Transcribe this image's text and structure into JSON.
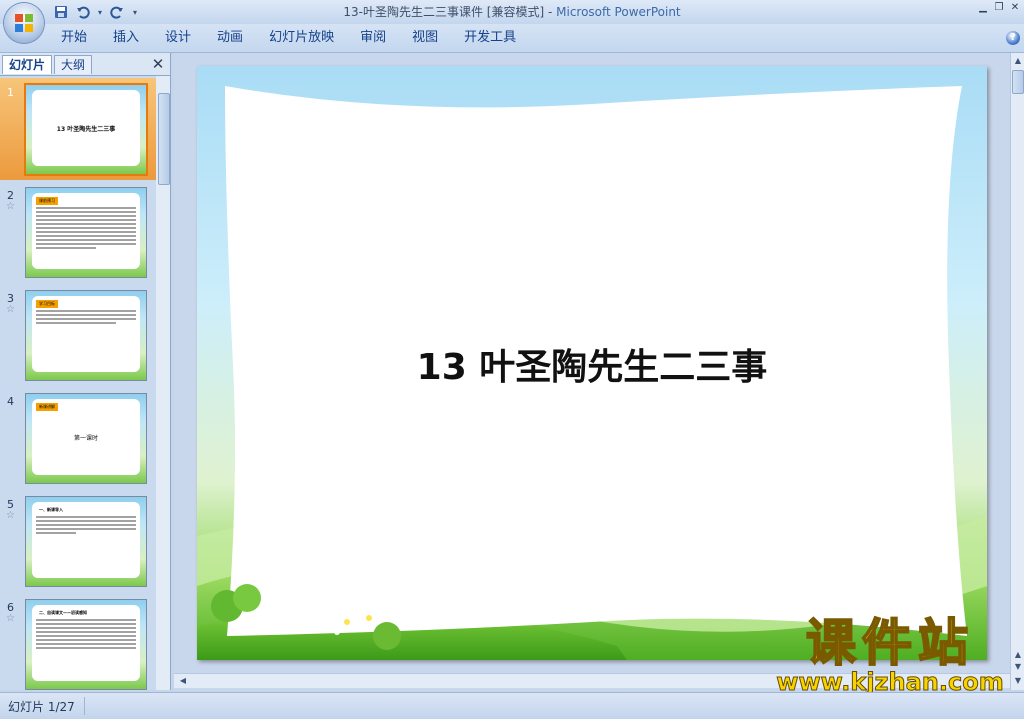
{
  "window": {
    "title": "13-叶圣陶先生二三事课件 [兼容模式]",
    "separator": " - ",
    "app_name": "Microsoft PowerPoint"
  },
  "ribbon": {
    "tabs": [
      "开始",
      "插入",
      "设计",
      "动画",
      "幻灯片放映",
      "审阅",
      "视图",
      "开发工具"
    ]
  },
  "slides_pane": {
    "tab_slides": "幻灯片",
    "tab_outline": "大纲",
    "thumbnails": [
      {
        "num": "1",
        "title": "13  叶圣陶先生二三事",
        "selected": true
      },
      {
        "num": "2",
        "tag": "课前预习"
      },
      {
        "num": "3",
        "tag": "学习目标"
      },
      {
        "num": "4",
        "tag": "新课讲解",
        "title": "第一课时"
      },
      {
        "num": "5",
        "tag": "一、新课导入"
      },
      {
        "num": "6",
        "tag": "二、自读课文——初读感知"
      }
    ]
  },
  "slide": {
    "title": "13  叶圣陶先生二三事"
  },
  "status_bar": {
    "slide_counter": "幻灯片 1/27"
  },
  "watermark": {
    "cn": "课件站",
    "url": "www.kjzhan.com"
  },
  "colors": {
    "selected_thumb": "#ec9a3d",
    "accent": "#15428b",
    "watermark": "#f5d400"
  }
}
